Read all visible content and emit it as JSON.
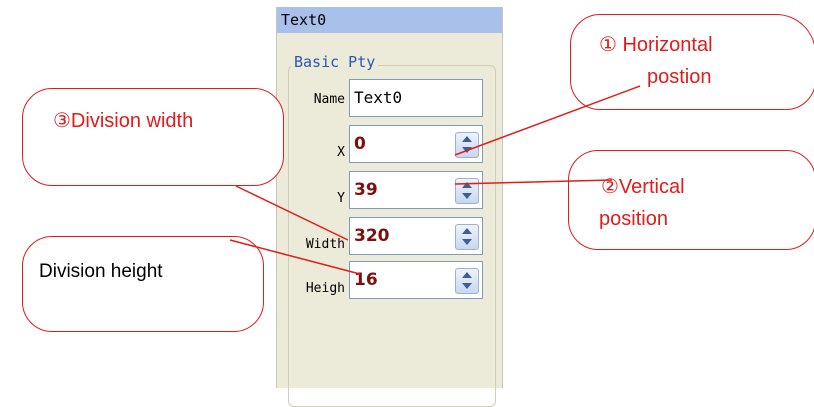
{
  "panel": {
    "title": "Text0",
    "group_title": "Basic Pty",
    "fields": [
      {
        "key": "name",
        "label": "Name",
        "value": "Text0"
      },
      {
        "key": "x",
        "label": "X",
        "value": "0"
      },
      {
        "key": "y",
        "label": "Y",
        "value": "39"
      },
      {
        "key": "width",
        "label": "Width",
        "value": "320"
      },
      {
        "key": "height",
        "label": "Heigh",
        "value": "16"
      }
    ]
  },
  "callouts": {
    "horizontal": "① Horizontal postion",
    "horizontal_line1": "① Horizontal",
    "horizontal_line2": "postion",
    "vertical_line1": "②Vertical",
    "vertical_line2": "position",
    "division_width": "③Division width",
    "division_height": "Division height"
  },
  "colors": {
    "callout_red": "#e21b1b",
    "title_bar": "#a9c0ea",
    "panel_bg": "#ecead8",
    "value_dark_red": "#7a1010"
  }
}
